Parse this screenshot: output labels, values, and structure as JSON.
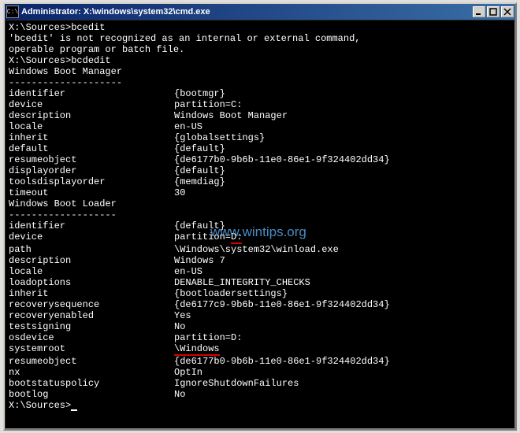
{
  "window": {
    "title": "Administrator: X:\\windows\\system32\\cmd.exe",
    "icon_text": "C:\\"
  },
  "prompt1": {
    "path": "X:\\Sources>",
    "cmd": "bcedit"
  },
  "error": {
    "line1": "'bcedit' is not recognized as an internal or external command,",
    "line2": "operable program or batch file."
  },
  "prompt2": {
    "path": "X:\\Sources>",
    "cmd": "bcdedit"
  },
  "boot_manager": {
    "header": "Windows Boot Manager",
    "underline": "--------------------",
    "rows": [
      {
        "k": "identifier",
        "v": "{bootmgr}"
      },
      {
        "k": "device",
        "v": "partition=C:"
      },
      {
        "k": "description",
        "v": "Windows Boot Manager"
      },
      {
        "k": "locale",
        "v": "en-US"
      },
      {
        "k": "inherit",
        "v": "{globalsettings}"
      },
      {
        "k": "default",
        "v": "{default}"
      },
      {
        "k": "resumeobject",
        "v": "{de6177b0-9b6b-11e0-86e1-9f324402dd34}"
      },
      {
        "k": "displayorder",
        "v": "{default}"
      },
      {
        "k": "toolsdisplayorder",
        "v": "{memdiag}"
      },
      {
        "k": "timeout",
        "v": "30"
      }
    ]
  },
  "boot_loader": {
    "header": "Windows Boot Loader",
    "underline": "-------------------",
    "rows": [
      {
        "k": "identifier",
        "v": "{default}"
      },
      {
        "k": "device",
        "v_pre": "partition=",
        "v_hl": "D:",
        "v_post": ""
      },
      {
        "k": "path",
        "v": "\\Windows\\system32\\winload.exe"
      },
      {
        "k": "description",
        "v": "Windows 7"
      },
      {
        "k": "locale",
        "v": "en-US"
      },
      {
        "k": "loadoptions",
        "v": "DENABLE_INTEGRITY_CHECKS"
      },
      {
        "k": "inherit",
        "v": "{bootloadersettings}"
      },
      {
        "k": "recoverysequence",
        "v": "{de6177c9-9b6b-11e0-86e1-9f324402dd34}"
      },
      {
        "k": "recoveryenabled",
        "v": "Yes"
      },
      {
        "k": "testsigning",
        "v": "No"
      },
      {
        "k": "osdevice",
        "v": "partition=D:"
      },
      {
        "k": "systemroot",
        "v_pre": "",
        "v_hl": "\\Windows",
        "v_post": ""
      },
      {
        "k": "resumeobject",
        "v": "{de6177b0-9b6b-11e0-86e1-9f324402dd34}"
      },
      {
        "k": "nx",
        "v": "OptIn"
      },
      {
        "k": "bootstatuspolicy",
        "v": "IgnoreShutdownFailures"
      },
      {
        "k": "bootlog",
        "v": "No"
      }
    ]
  },
  "prompt3": {
    "path": "X:\\Sources>"
  },
  "watermark": "www.wintips.org"
}
